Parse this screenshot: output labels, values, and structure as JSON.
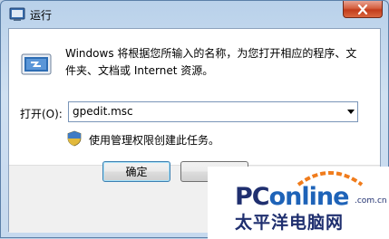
{
  "window": {
    "title": "运行",
    "close_icon": "close-icon"
  },
  "content": {
    "description": "Windows 将根据您所输入的名称，为您打开相应的程序、文件夹、文档或 Internet 资源。",
    "open_label": "打开(O):",
    "open_value": "gpedit.msc",
    "admin_note": "使用管理权限创建此任务。"
  },
  "buttons": {
    "ok": "确定",
    "cancel": "取"
  },
  "watermark": {
    "logo_pc": "PC",
    "logo_online": "online",
    "domain": ".com.cn",
    "chinese": "太平洋电脑网"
  },
  "colors": {
    "accent": "#3c7fb1",
    "close": "#c23c1b",
    "brand": "#1f2f6f"
  }
}
